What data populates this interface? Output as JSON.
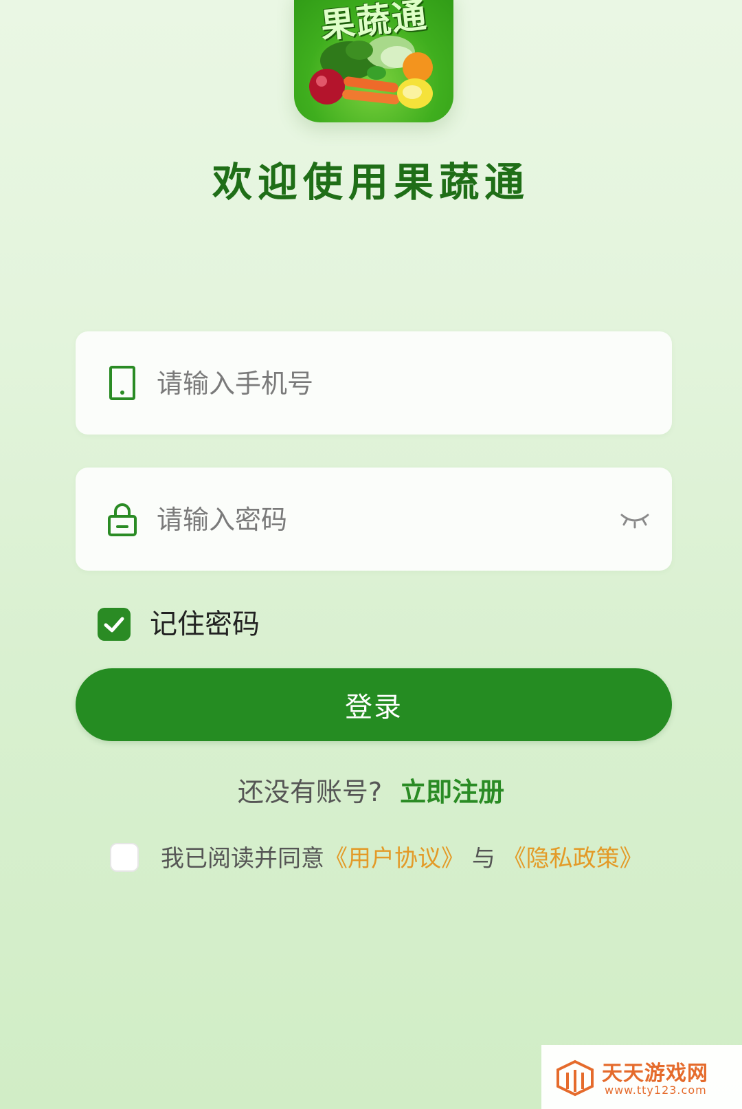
{
  "app": {
    "logo_text": "果蔬通",
    "welcome_title": "欢迎使用果蔬通"
  },
  "login_form": {
    "phone_placeholder": "请输入手机号",
    "password_placeholder": "请输入密码",
    "remember_password_label": "记住密码",
    "remember_password_checked": true,
    "login_button_label": "登录"
  },
  "register": {
    "prompt": "还没有账号?",
    "link_label": "立即注册"
  },
  "agreement": {
    "checked": false,
    "prefix": "我已阅读并同意",
    "user_agreement": "《用户协议》",
    "conjunction": "与",
    "privacy_policy": "《隐私政策》"
  },
  "watermark": {
    "title": "天天游戏网",
    "url": "www.tty123.com"
  },
  "icons": {
    "phone": "phone-icon",
    "lock": "lock-icon",
    "eye_closed": "eye-closed-icon",
    "check": "check-icon"
  },
  "colors": {
    "primary_green": "#258c22",
    "title_green": "#1f6e17",
    "link_orange": "#e39a27",
    "background": "#e3f4dc"
  }
}
